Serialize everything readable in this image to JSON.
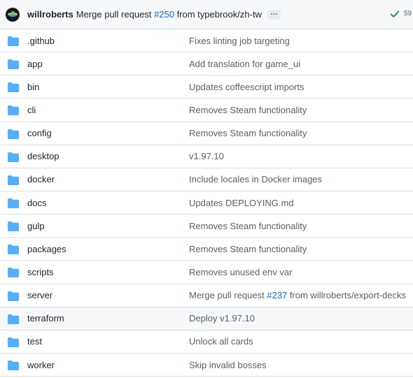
{
  "latest_commit": {
    "author": "willroberts",
    "message_prefix": "Merge pull request ",
    "pr_link": "#250",
    "message_suffix": " from typebrook/zh-tw",
    "ellipsis": "…",
    "status": "success",
    "count": "59"
  },
  "files": [
    {
      "name": ".github",
      "message": "Fixes linting job targeting"
    },
    {
      "name": "app",
      "message": "Add translation for game_ui"
    },
    {
      "name": "bin",
      "message": "Updates coffeescript imports"
    },
    {
      "name": "cli",
      "message": "Removes Steam functionality"
    },
    {
      "name": "config",
      "message": "Removes Steam functionality"
    },
    {
      "name": "desktop",
      "message": "v1.97.10"
    },
    {
      "name": "docker",
      "message": "Include locales in Docker images"
    },
    {
      "name": "docs",
      "message": "Updates DEPLOYING.md"
    },
    {
      "name": "gulp",
      "message": "Removes Steam functionality"
    },
    {
      "name": "packages",
      "message": "Removes Steam functionality"
    },
    {
      "name": "scripts",
      "message": "Removes unused env var"
    },
    {
      "name": "server",
      "message_prefix": "Merge pull request ",
      "pr_link": "#237",
      "message_suffix": " from willroberts/export-decks"
    },
    {
      "name": "terraform",
      "message": "Deploy v1.97.10"
    },
    {
      "name": "test",
      "message": "Unlock all cards"
    },
    {
      "name": "worker",
      "message": "Skip invalid bosses"
    }
  ],
  "colors": {
    "folder": "#54aeff",
    "link": "#0969da",
    "success": "#1a7f37"
  }
}
